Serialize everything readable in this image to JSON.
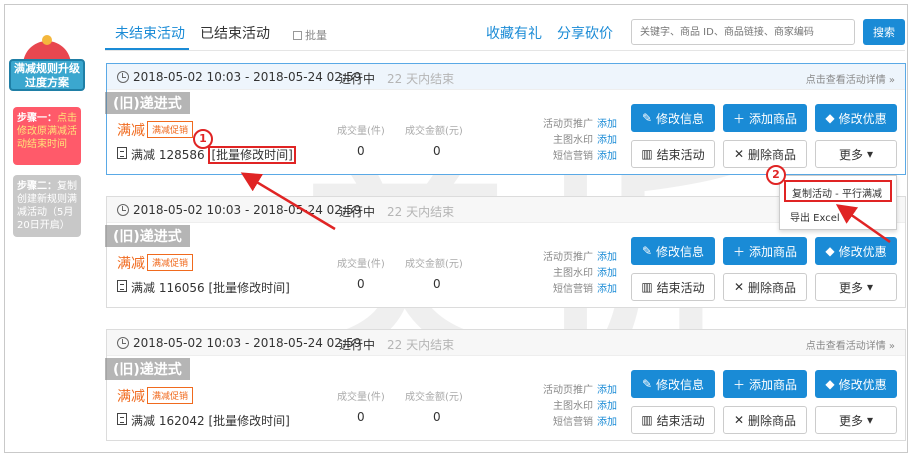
{
  "watermark": "美折",
  "sidebar": {
    "badge_title": "满减规则升级\n过度方案",
    "step1": {
      "head": "步骤一：",
      "body": "点击修改原满减活动结束时间"
    },
    "step2": {
      "head": "步骤二：",
      "body": "复制创建新规则满减活动（5月20日开启）"
    }
  },
  "tabs": {
    "active": "未结束活动",
    "ended": "已结束活动",
    "batch": "批量"
  },
  "links": {
    "favorite": "收藏有礼",
    "share": "分享砍价"
  },
  "search": {
    "placeholder": "关键字、商品 ID、商品链接、商家编码",
    "button": "搜索"
  },
  "common": {
    "status": "进行中",
    "ending": "22 天内结束",
    "detail": "点击查看活动详情 »",
    "old_tag": "(旧)递进式",
    "mj": "满减",
    "promo_tag": "满减促销",
    "batch_time": "[批量修改时间]",
    "stat_count": "成交量(件)",
    "stat_amount": "成交金额(元)",
    "promo_rows": [
      "活动页推广",
      "主图水印",
      "短信营销"
    ],
    "add": "添加",
    "btn_edit": "修改信息",
    "btn_add": "添加商品",
    "btn_modify": "修改优惠",
    "btn_end": "结束活动",
    "btn_delete": "删除商品",
    "btn_more": "更多"
  },
  "cards": [
    {
      "date": "2018-05-02 10:03 - 2018-05-24 02:59",
      "id": "满减 128586",
      "count": "0",
      "amount": "0"
    },
    {
      "date": "2018-05-02 10:03 - 2018-05-24 02:59",
      "id": "满减 116056",
      "count": "0",
      "amount": "0"
    },
    {
      "date": "2018-05-02 10:03 - 2018-05-24 02:59",
      "id": "满减 162042",
      "count": "0",
      "amount": "0"
    }
  ],
  "dropdown": {
    "copy": "复制活动 - 平行满减",
    "export": "导出 Excel"
  },
  "callouts": {
    "one": "1",
    "two": "2"
  },
  "colors": {
    "accent": "#1a8bd6",
    "orange": "#f06a1e",
    "annotation": "#e02424"
  }
}
